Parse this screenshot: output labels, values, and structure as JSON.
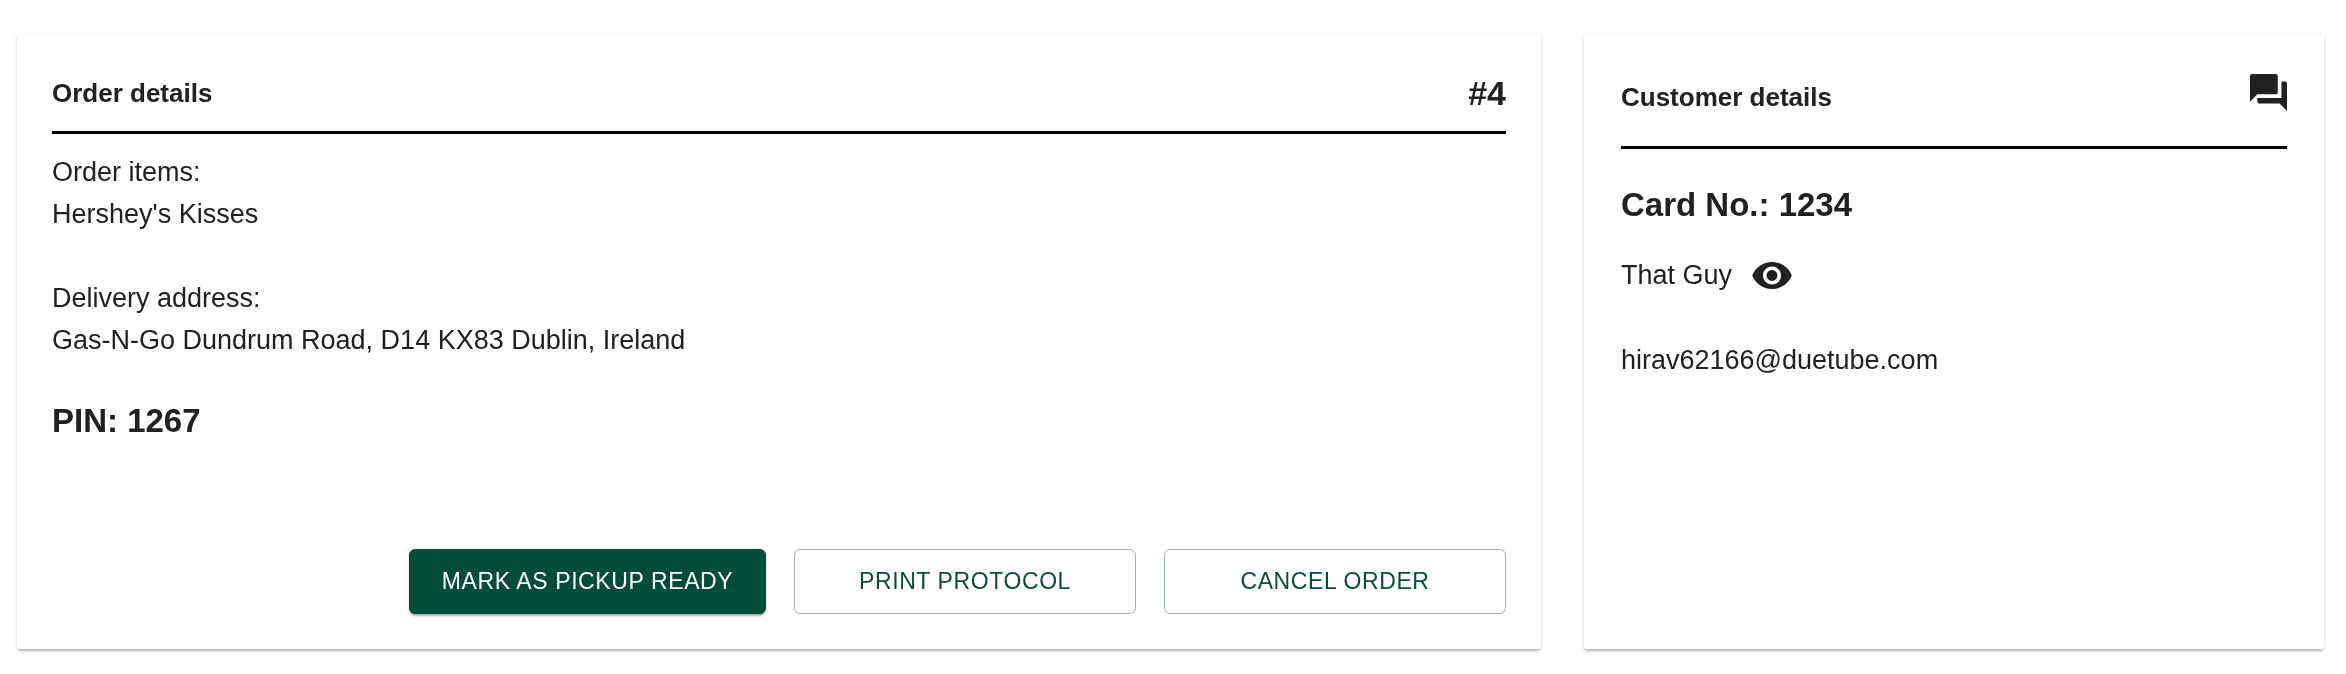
{
  "order_details": {
    "title": "Order details",
    "number": "#4",
    "sections": [
      {
        "label": "Order items:",
        "value": "Hershey's Kisses"
      },
      {
        "label": "Delivery address:",
        "value": "Gas-N-Go Dundrum Road, D14 KX83 Dublin, Ireland"
      }
    ],
    "pin": "PIN: 1267",
    "buttons": [
      {
        "label": "MARK AS PICKUP READY",
        "kind": "primary"
      },
      {
        "label": "PRINT PROTOCOL",
        "kind": "outlined"
      },
      {
        "label": "CANCEL ORDER",
        "kind": "outlined"
      }
    ]
  },
  "customer_details": {
    "title": "Customer details",
    "card_number": "Card No.: 1234",
    "name": "That Guy",
    "email": "hirav62166@duetube.com"
  }
}
